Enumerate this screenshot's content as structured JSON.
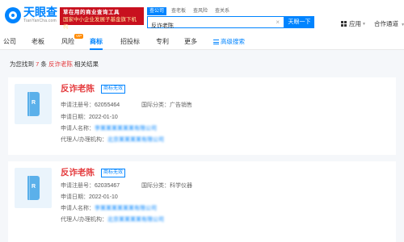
{
  "header": {
    "logo_name": "天眼查",
    "logo_domain": "TianYanCha.com",
    "ad_line1": "草在用的商业查询工具",
    "ad_line2": "国家中小企业发展子基金旗下机构",
    "search_tabs": [
      "查公司",
      "查老板",
      "查风险",
      "查关系"
    ],
    "search_value": "反诈老陈",
    "search_button": "天眼一下",
    "apps_label": "应用",
    "partner_label": "合作通道"
  },
  "nav": {
    "items": [
      "公司",
      "老板",
      "风险",
      "商标",
      "招投标",
      "专利",
      "更多"
    ],
    "active": "商标",
    "vip_badge": "VIP",
    "advanced_search": "高级搜索"
  },
  "results": {
    "prefix": "为您找到",
    "count": "7",
    "unit": "条",
    "keyword": "反诈老陈",
    "suffix": "相关结果"
  },
  "cards": [
    {
      "title": "反诈老陈",
      "status": "商标无效",
      "reg_no_label": "申请注册号：",
      "reg_no": "62055464",
      "class_label": "国际分类：",
      "class_value": "广告销售",
      "date_label": "申请日期：",
      "date": "2022-01-10",
      "applicant_label": "申请人名称：",
      "applicant": "李某某某某某某有限公司",
      "agent_label": "代理人/办理机构：",
      "agent": "北京某某某某有限公司"
    },
    {
      "title": "反诈老陈",
      "status": "商标无效",
      "reg_no_label": "申请注册号：",
      "reg_no": "62035467",
      "class_label": "国际分类：",
      "class_value": "科学仪器",
      "date_label": "申请日期：",
      "date": "2022-01-10",
      "applicant_label": "申请人名称：",
      "applicant": "李某某某某某某有限公司",
      "agent_label": "代理人/办理机构：",
      "agent": "北京某某某某有限公司"
    }
  ],
  "colors": {
    "brand": "#0084ff",
    "highlight": "#e4393c",
    "ad": "#c8101e"
  }
}
